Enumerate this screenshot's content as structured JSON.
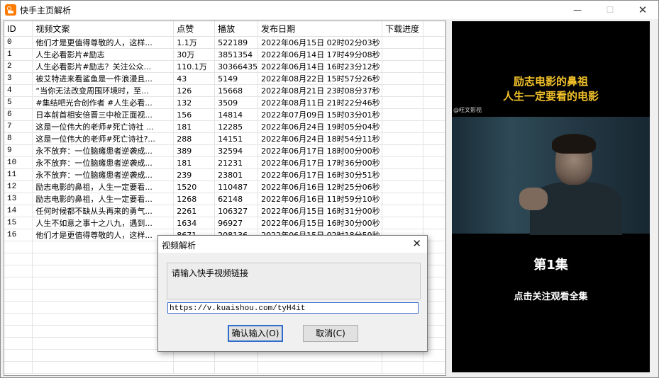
{
  "window": {
    "title": "快手主页解析",
    "min_label": "—",
    "max_label": "☐",
    "close_label": "✕"
  },
  "table": {
    "columns": [
      "ID",
      "视频文案",
      "点赞",
      "播放",
      "发布日期",
      "下载进度"
    ],
    "rows": [
      [
        "0",
        "他们才是更值得尊敬的人，这样...",
        "1.1万",
        "522189",
        "2022年06月15日 02时02分03秒",
        ""
      ],
      [
        "1",
        "人生必看影片#励志",
        "30万",
        "3851354",
        "2022年06月14日 17时49分08秒",
        ""
      ],
      [
        "2",
        "人生必看影片#励志？关注公众...",
        "110.1万",
        "30366435",
        "2022年06月14日 16时23分12秒",
        ""
      ],
      [
        "3",
        "被艾特进来看鲨鱼是一件浪漫且...",
        "43",
        "5149",
        "2022年08月22日 15时57分26秒",
        ""
      ],
      [
        "4",
        "“当你无法改变周围环境时，至...",
        "126",
        "15668",
        "2022年08月21日 23时08分37秒",
        ""
      ],
      [
        "5",
        "#集结吧光合创作者 #人生必看...",
        "132",
        "3509",
        "2022年08月11日 21时22分46秒",
        ""
      ],
      [
        "6",
        "日本前首相安倍晋三中枪正面视...",
        "156",
        "14814",
        "2022年07月09日 15时03分01秒",
        ""
      ],
      [
        "7",
        "这是一位伟大的老师#死亡诗社 ...",
        "181",
        "12285",
        "2022年06月24日 19时05分04秒",
        ""
      ],
      [
        "8",
        "这是一位伟大的老师#死亡诗社?...",
        "288",
        "14151",
        "2022年06月24日 18时54分11秒",
        ""
      ],
      [
        "9",
        "永不放弃：一位脑瘫患者逆袭成...",
        "389",
        "32594",
        "2022年06月17日 18时00分00秒",
        ""
      ],
      [
        "10",
        "永不放弃：一位脑瘫患者逆袭成...",
        "181",
        "21231",
        "2022年06月17日 17时36分00秒",
        ""
      ],
      [
        "11",
        "永不放弃：一位脑瘫患者逆袭成...",
        "239",
        "23801",
        "2022年06月17日 16时30分51秒",
        ""
      ],
      [
        "12",
        "励志电影的鼻祖，人生一定要看...",
        "1520",
        "110487",
        "2022年06月16日 12时25分06秒",
        ""
      ],
      [
        "13",
        "励志电影的鼻祖，人生一定要看...",
        "1268",
        "62148",
        "2022年06月16日 11时59分10秒",
        ""
      ],
      [
        "14",
        "任何时候都不缺从头再来的勇气...",
        "2261",
        "106327",
        "2022年06月15日 16时31分00秒",
        ""
      ],
      [
        "15",
        "人生不如意之事十之八九，遇到...",
        "1634",
        "96927",
        "2022年06月15日 16时30分00秒",
        ""
      ],
      [
        "16",
        "他们才是更值得尊敬的人，这样...",
        "8671",
        "208136",
        "2022年06月15日 02时18分59秒",
        ""
      ]
    ]
  },
  "preview": {
    "title_line1": "励志电影的鼻祖",
    "title_line2": "人生一定要看的电影",
    "watermark": "@旺文影视",
    "episode": "第1集",
    "subtitle": "点击关注观看全集"
  },
  "dialog": {
    "title": "视频解析",
    "close_label": "✕",
    "prompt": "请输入快手视频链接",
    "input_value": "https://v.kuaishou.com/tyH4it",
    "ok_label": "确认输入(O)",
    "cancel_label": "取消(C)"
  }
}
